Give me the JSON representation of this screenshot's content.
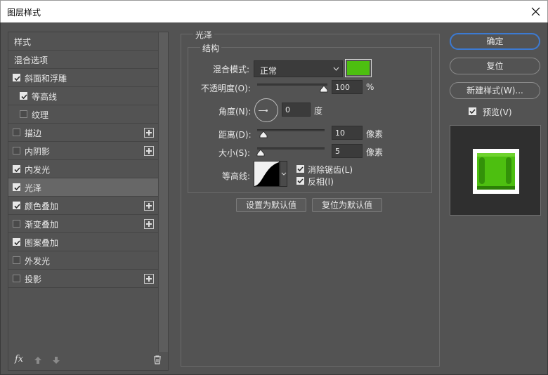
{
  "window": {
    "title": "图层样式"
  },
  "styles_list": {
    "items": [
      {
        "label": "样式",
        "checkbox": false,
        "checked": false,
        "plus": false,
        "selected": false,
        "indent": 0
      },
      {
        "label": "混合选项",
        "checkbox": false,
        "checked": false,
        "plus": false,
        "selected": false,
        "indent": 0
      },
      {
        "label": "斜面和浮雕",
        "checkbox": true,
        "checked": true,
        "plus": false,
        "selected": false,
        "indent": 0
      },
      {
        "label": "等高线",
        "checkbox": true,
        "checked": true,
        "plus": false,
        "selected": false,
        "indent": 1
      },
      {
        "label": "纹理",
        "checkbox": true,
        "checked": false,
        "plus": false,
        "selected": false,
        "indent": 1
      },
      {
        "label": "描边",
        "checkbox": true,
        "checked": false,
        "plus": true,
        "selected": false,
        "indent": 0
      },
      {
        "label": "内阴影",
        "checkbox": true,
        "checked": false,
        "plus": true,
        "selected": false,
        "indent": 0
      },
      {
        "label": "内发光",
        "checkbox": true,
        "checked": true,
        "plus": false,
        "selected": false,
        "indent": 0
      },
      {
        "label": "光泽",
        "checkbox": true,
        "checked": true,
        "plus": false,
        "selected": true,
        "indent": 0
      },
      {
        "label": "颜色叠加",
        "checkbox": true,
        "checked": true,
        "plus": true,
        "selected": false,
        "indent": 0
      },
      {
        "label": "渐变叠加",
        "checkbox": true,
        "checked": false,
        "plus": true,
        "selected": false,
        "indent": 0
      },
      {
        "label": "图案叠加",
        "checkbox": true,
        "checked": true,
        "plus": false,
        "selected": false,
        "indent": 0
      },
      {
        "label": "外发光",
        "checkbox": true,
        "checked": false,
        "plus": false,
        "selected": false,
        "indent": 0
      },
      {
        "label": "投影",
        "checkbox": true,
        "checked": false,
        "plus": true,
        "selected": false,
        "indent": 0
      }
    ],
    "fx_label": "fx"
  },
  "satin": {
    "section_title": "光泽",
    "structure_title": "结构",
    "blend_mode_label": "混合模式:",
    "blend_mode_value": "正常",
    "color": "#4dbf10",
    "opacity_label": "不透明度(O):",
    "opacity_value": "100",
    "opacity_unit": "%",
    "angle_label": "角度(N):",
    "angle_value": "0",
    "angle_unit": "度",
    "distance_label": "距离(D):",
    "distance_value": "10",
    "distance_unit": "像素",
    "size_label": "大小(S):",
    "size_value": "5",
    "size_unit": "像素",
    "contour_label": "等高线:",
    "antialias_label": "消除锯齿(L)",
    "antialias_checked": true,
    "invert_label": "反相(I)",
    "invert_checked": true,
    "make_default_label": "设置为默认值",
    "reset_default_label": "复位为默认值"
  },
  "actions": {
    "ok_label": "确定",
    "reset_label": "复位",
    "new_style_label": "新建样式(W)...",
    "preview_label": "预览(V)",
    "preview_checked": true
  }
}
